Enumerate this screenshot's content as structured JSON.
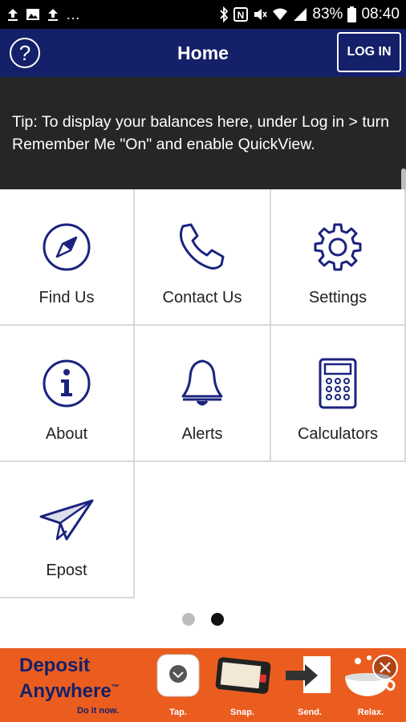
{
  "status_bar": {
    "battery": "83%",
    "time": "08:40",
    "left_icons": [
      "upload-icon",
      "image-icon",
      "upload-icon",
      "more-icon"
    ],
    "right_icons": [
      "bluetooth-icon",
      "nfc-icon",
      "mute-icon",
      "wifi-icon",
      "signal-icon",
      "battery-icon"
    ]
  },
  "header": {
    "title": "Home",
    "help_label": "?",
    "login_label": "LOG IN"
  },
  "tip": {
    "text": "Tip: To display your balances here, under Log in > turn Remember Me \"On\" and enable QuickView."
  },
  "menu": {
    "items": [
      {
        "label": "Find Us",
        "icon": "compass-icon"
      },
      {
        "label": "Contact Us",
        "icon": "phone-icon"
      },
      {
        "label": "Settings",
        "icon": "gear-icon"
      },
      {
        "label": "About",
        "icon": "info-icon"
      },
      {
        "label": "Alerts",
        "icon": "bell-icon"
      },
      {
        "label": "Calculators",
        "icon": "calculator-icon"
      },
      {
        "label": "Epost",
        "icon": "paper-plane-icon"
      }
    ]
  },
  "pager": {
    "pages": 2,
    "active": 2
  },
  "ad": {
    "title_line1": "Deposit",
    "title_line2": "Anywhere",
    "trademark": "™",
    "tagline": "Do it now.",
    "steps": [
      "Tap.",
      "Snap.",
      "Send.",
      "Relax."
    ]
  },
  "colors": {
    "brand_navy": "#142069",
    "tip_bg": "#262626",
    "ad_orange": "#ea5d1f",
    "icon_navy": "#1a237e"
  }
}
